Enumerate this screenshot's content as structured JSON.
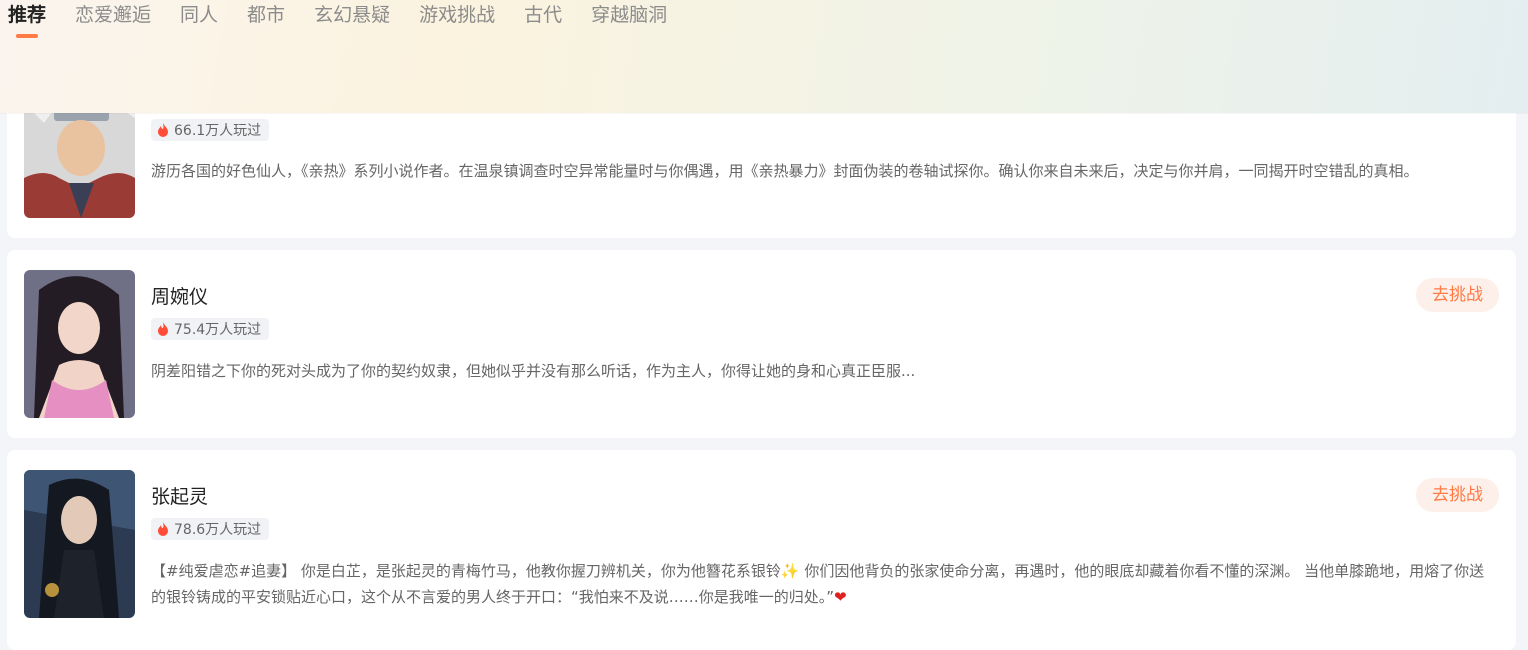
{
  "tabs": [
    {
      "label": "推荐",
      "active": true
    },
    {
      "label": "恋爱邂逅",
      "active": false
    },
    {
      "label": "同人",
      "active": false
    },
    {
      "label": "都市",
      "active": false
    },
    {
      "label": "玄幻悬疑",
      "active": false
    },
    {
      "label": "游戏挑战",
      "active": false
    },
    {
      "label": "古代",
      "active": false
    },
    {
      "label": "穿越脑洞",
      "active": false
    }
  ],
  "cards": [
    {
      "plays": "66.1万人玩过",
      "description": "游历各国的好色仙人，《亲热》系列小说作者。在温泉镇调查时空异常能量时与你偶遇，用《亲热暴力》封面伪装的卷轴试探你。确认你来自未来后，决定与你并肩，一同揭开时空错乱的真相。"
    },
    {
      "name": "周婉仪",
      "plays": "75.4万人玩过",
      "description": "阴差阳错之下你的死对头成为了你的契约奴隶，但她似乎并没有那么听话，作为主人，你得让她的身和心真正臣服...",
      "button": "去挑战"
    },
    {
      "name": "张起灵",
      "plays": "78.6万人玩过",
      "description_part1": "【#纯爱虐恋#追妻】 你是白芷，是张起灵的青梅竹马，他教你握刀辨机关，你为他簪花系银铃",
      "description_part2": " 你们因他背负的张家使命分离，再遇时，他的眼底却藏着你看不懂的深渊。 当他单膝跪地，用熔了你送的银铃铸成的平安锁贴近心口，这个从不言爱的男人终于开口：“我怕来不及说……你是我唯一的归处。”",
      "button": "去挑战"
    }
  ],
  "colors": {
    "accent": "#ff7a45",
    "button_bg": "#fdf0ea"
  },
  "icons": {
    "plays": "fire-icon",
    "sparkle": "sparkle-icon",
    "heart": "heart-icon"
  }
}
